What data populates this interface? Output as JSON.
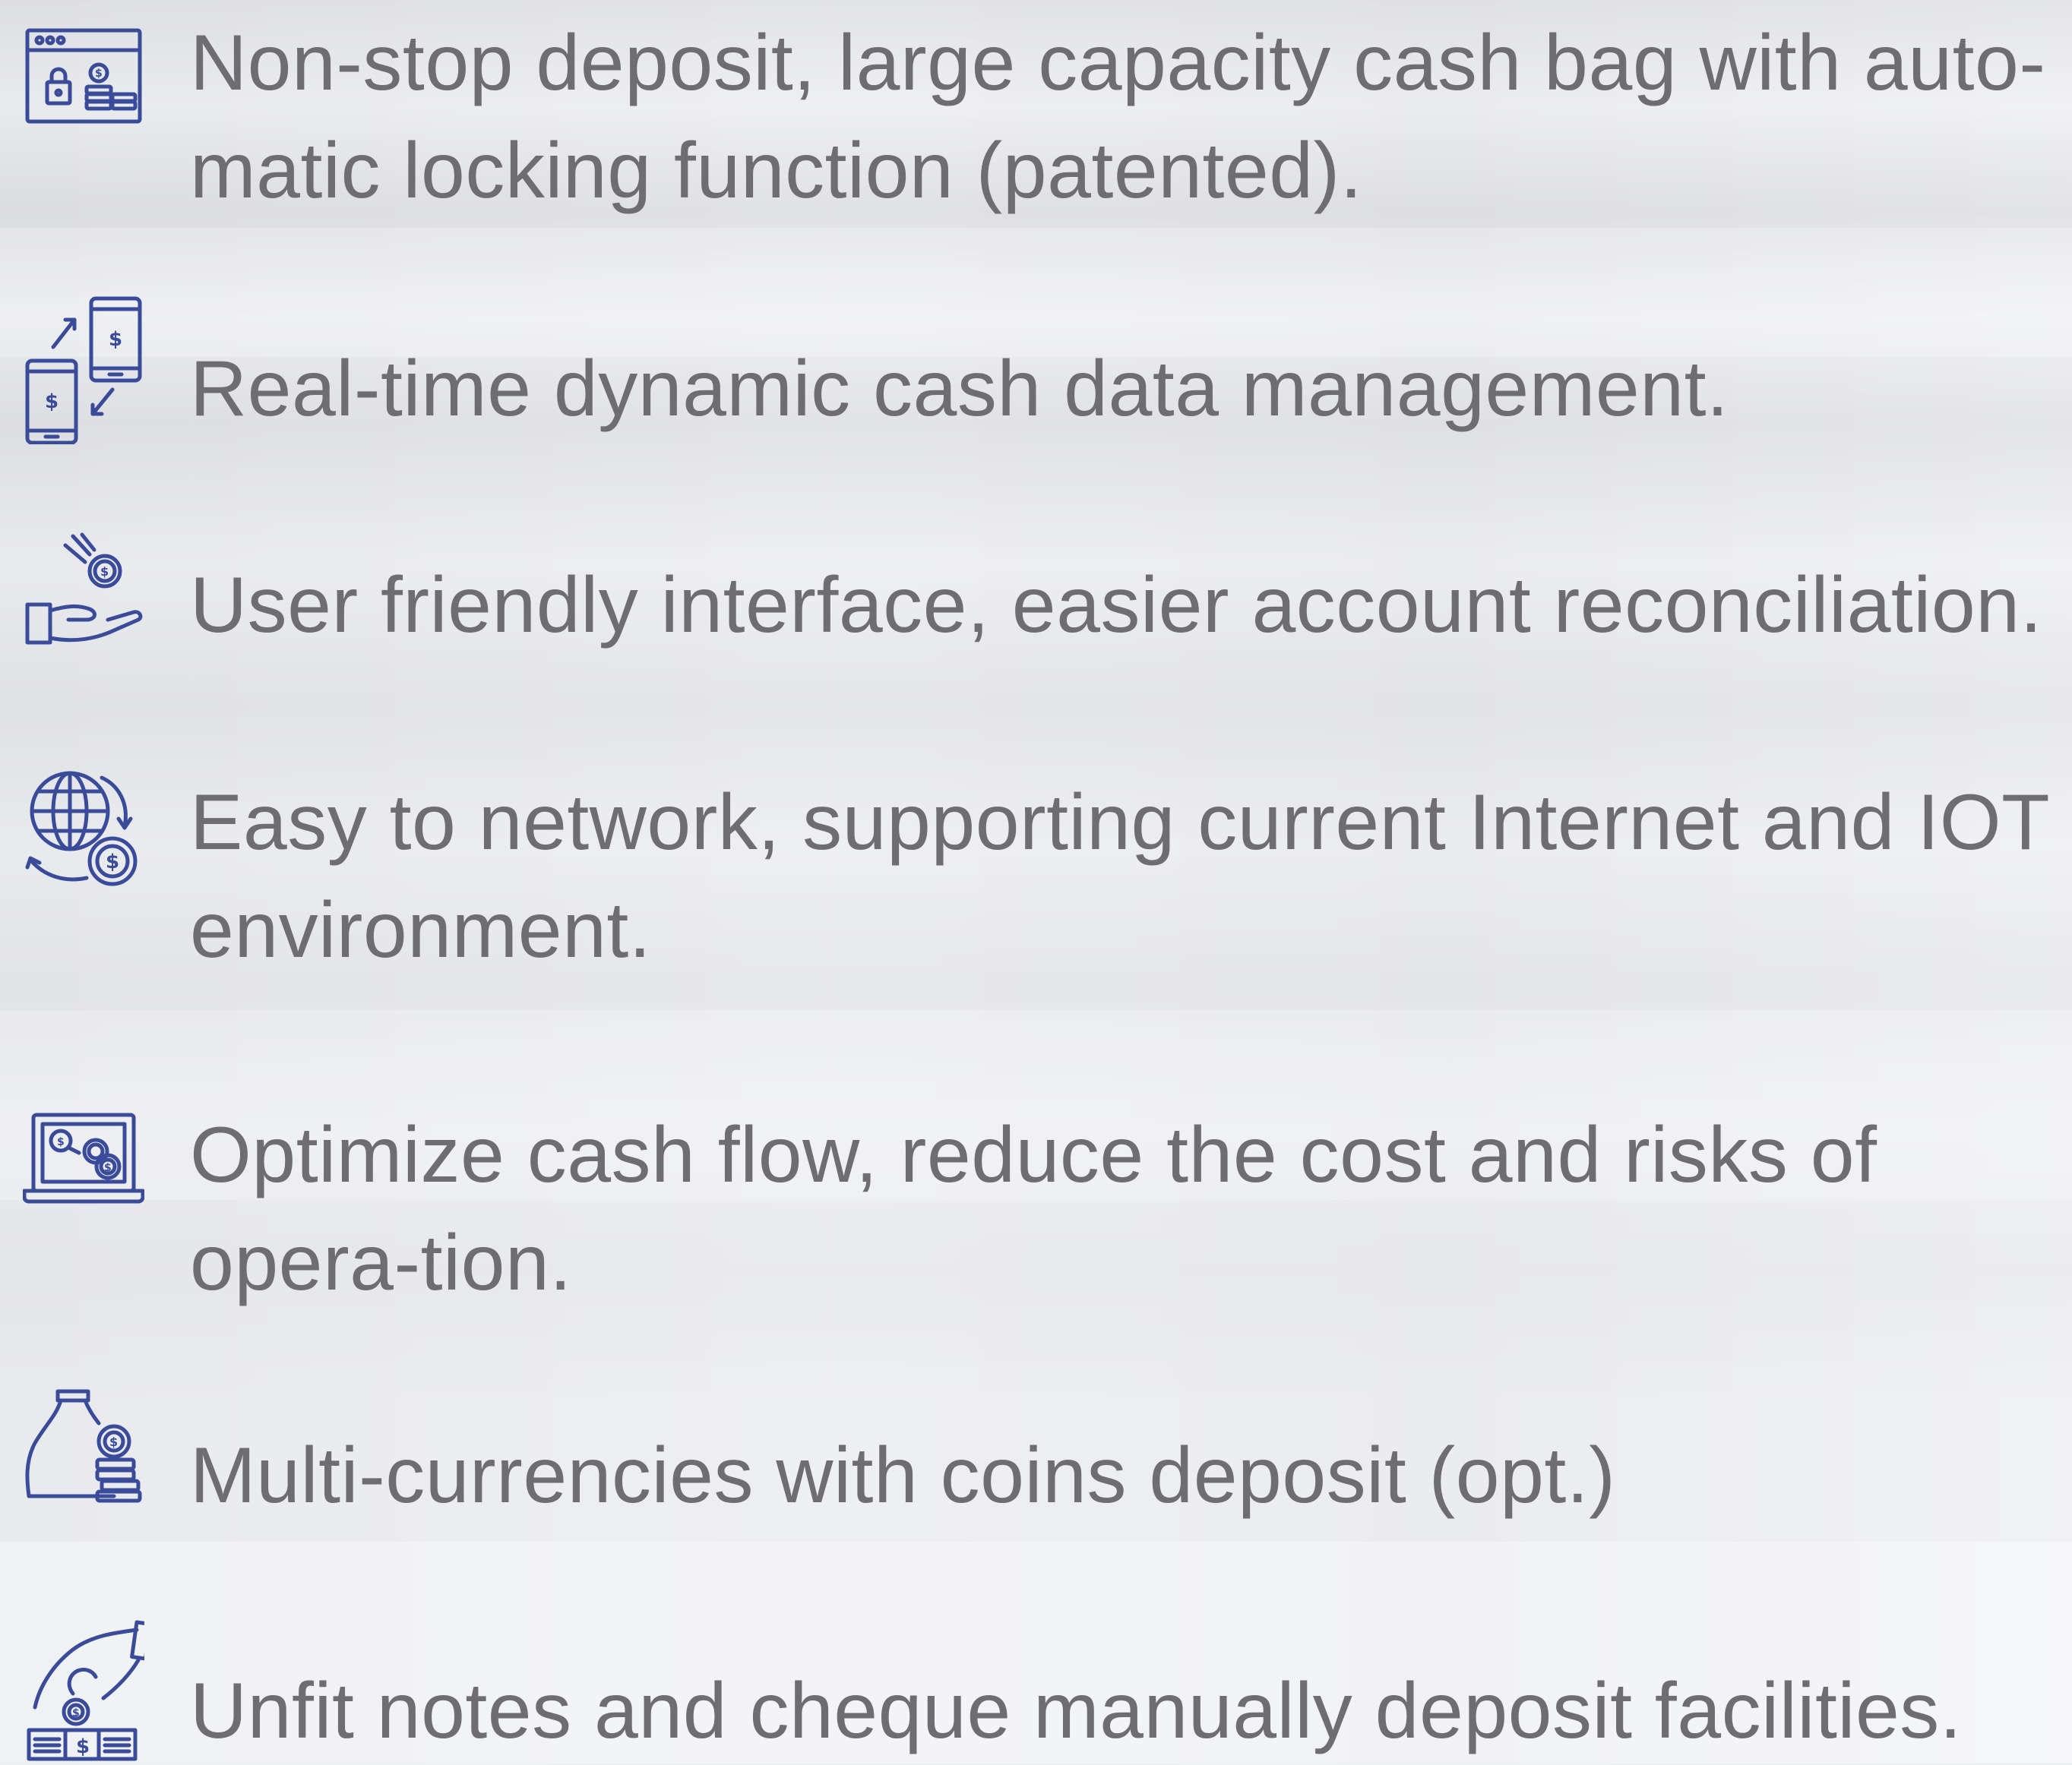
{
  "accent_color": "#3a4b9a",
  "text_color": "#6e6e70",
  "features": [
    {
      "icon": "cash-bag-lock-icon",
      "text": "Non-stop deposit, large capacity cash bag with auto-matic locking function (patented)."
    },
    {
      "icon": "mobile-transfer-icon",
      "text": "Real-time dynamic cash data management."
    },
    {
      "icon": "hand-coin-icon",
      "text": "User friendly interface, easier account reconciliation."
    },
    {
      "icon": "globe-coin-icon",
      "text": "Easy to network, supporting current Internet and IOT environment."
    },
    {
      "icon": "laptop-coins-icon",
      "text": "Optimize cash flow, reduce the cost and risks of opera-tion."
    },
    {
      "icon": "money-bag-coins-icon",
      "text": "Multi-currencies with coins deposit (opt.)"
    },
    {
      "icon": "hand-deposit-cheque-icon",
      "text": "Unfit notes and cheque manually deposit facilities."
    }
  ]
}
